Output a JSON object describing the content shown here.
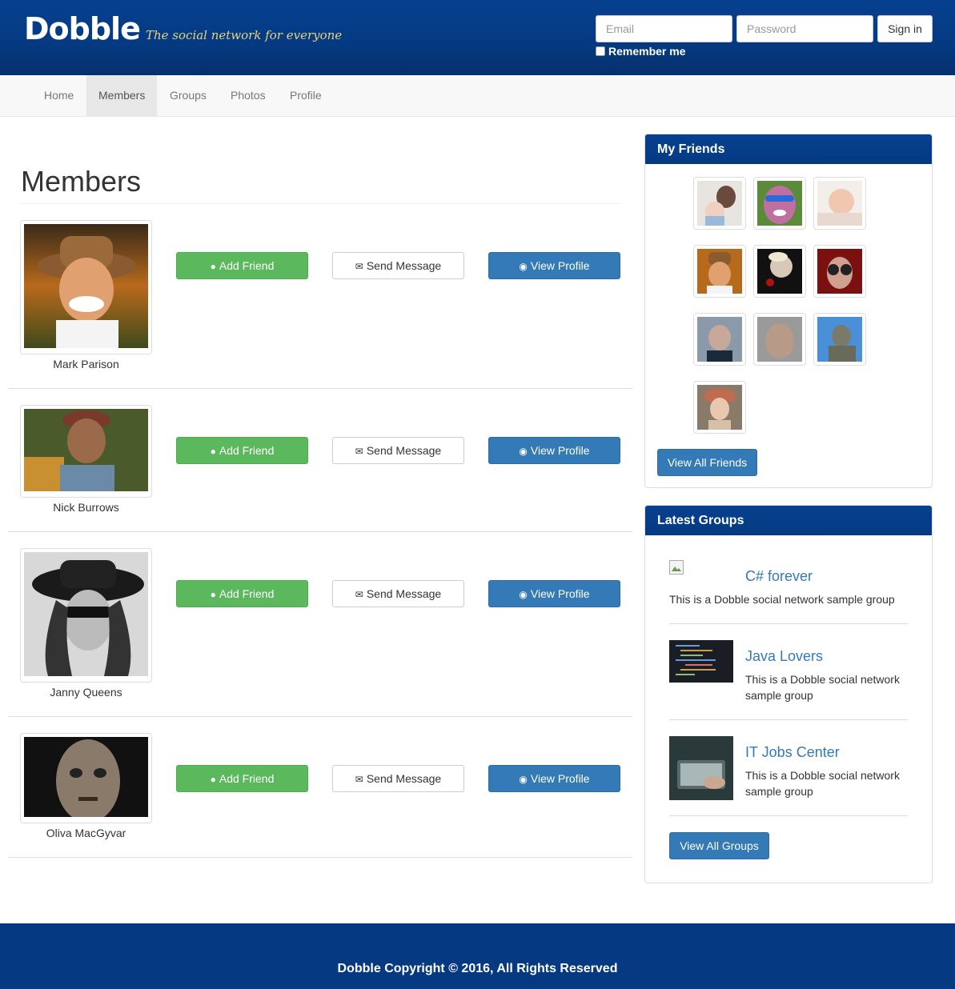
{
  "brand": {
    "logo": "Dobble",
    "tagline": "The social network for everyone"
  },
  "login": {
    "email_placeholder": "Email",
    "password_placeholder": "Password",
    "signin_label": "Sign in",
    "remember_label": "Remember me"
  },
  "nav": {
    "items": [
      {
        "label": "Home",
        "active": false
      },
      {
        "label": "Members",
        "active": true
      },
      {
        "label": "Groups",
        "active": false
      },
      {
        "label": "Photos",
        "active": false
      },
      {
        "label": "Profile",
        "active": false
      }
    ]
  },
  "main": {
    "title": "Members",
    "members": [
      {
        "name": "Mark Parison",
        "add_label": "Add Friend",
        "message_label": "Send Message",
        "view_label": "View Profile"
      },
      {
        "name": "Nick Burrows",
        "add_label": "Add Friend",
        "message_label": "Send Message",
        "view_label": "View Profile"
      },
      {
        "name": "Janny Queens",
        "add_label": "Add Friend",
        "message_label": "Send Message",
        "view_label": "View Profile"
      },
      {
        "name": "Oliva MacGyvar",
        "add_label": "Add Friend",
        "message_label": "Send Message",
        "view_label": "View Profile"
      }
    ]
  },
  "sidebar": {
    "friends": {
      "title": "My Friends",
      "button_label": "View All Friends"
    },
    "groups": {
      "title": "Latest Groups",
      "items": [
        {
          "name": "C# forever",
          "description": "This is a Dobble social network sample group"
        },
        {
          "name": "Java Lovers",
          "description": "This is a Dobble social network sample group"
        },
        {
          "name": "IT Jobs Center",
          "description": "This is a Dobble social network sample group"
        }
      ],
      "button_label": "View All Groups"
    }
  },
  "footer": {
    "text": "Dobble Copyright © 2016, All Rights Reserved"
  },
  "colors": {
    "header": "#053a82",
    "success": "#5cb85c",
    "primary": "#337ab7"
  }
}
